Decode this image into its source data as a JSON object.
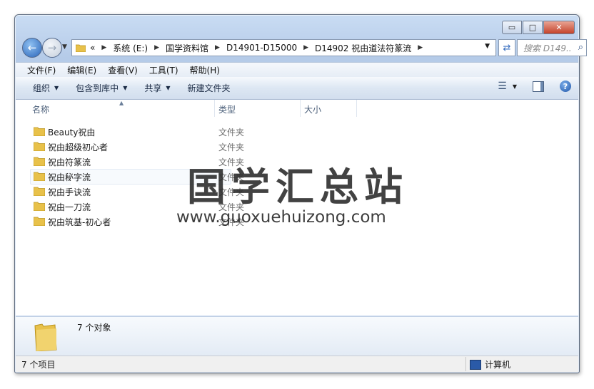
{
  "window": {
    "caption_buttons": {
      "minimize": "▭",
      "maximize": "□",
      "close": "✕"
    }
  },
  "nav": {
    "back_icon": "back-arrow-icon",
    "forward_icon": "forward-arrow-icon",
    "overflow": "«",
    "breadcrumbs": [
      "系统 (E:)",
      "国学资料馆",
      "D14901-D15000",
      "D14902 祝由道法符篆流"
    ],
    "search_placeholder": "搜索 D149..."
  },
  "menu": [
    "文件(F)",
    "编辑(E)",
    "查看(V)",
    "工具(T)",
    "帮助(H)"
  ],
  "commands": [
    {
      "label": "组织",
      "dropdown": true
    },
    {
      "label": "包含到库中",
      "dropdown": true
    },
    {
      "label": "共享",
      "dropdown": true
    },
    {
      "label": "新建文件夹",
      "dropdown": false
    }
  ],
  "columns": {
    "name": "名称",
    "type": "类型",
    "size": "大小"
  },
  "files": [
    {
      "name": "Beauty祝由",
      "type": "文件夹"
    },
    {
      "name": "祝由超级初心者",
      "type": "文件夹"
    },
    {
      "name": "祝由符篆流",
      "type": "文件夹"
    },
    {
      "name": "祝由秘字流",
      "type": "文件夹"
    },
    {
      "name": "祝由手诀流",
      "type": "文件夹"
    },
    {
      "name": "祝由一刀流",
      "type": "文件夹"
    },
    {
      "name": "祝由筑基-初心者",
      "type": "文件夹"
    }
  ],
  "details": {
    "count_text": "7 个对象"
  },
  "status": {
    "items_text": "7 个项目",
    "location": "计算机"
  },
  "watermark": {
    "title": "国学汇总站",
    "url": "www.guoxuehuizong.com"
  },
  "colors": {
    "folder": "#e8c14a",
    "accent": "#2a64b8"
  }
}
